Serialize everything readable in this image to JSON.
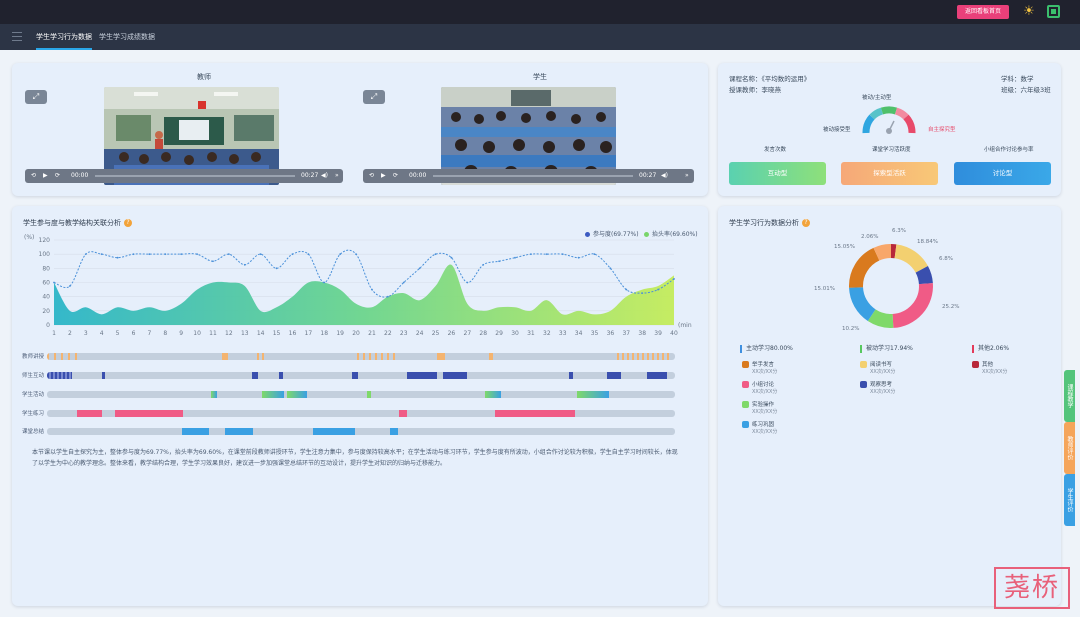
{
  "topbar": {
    "back_label": "返回看板首页",
    "theme_icon": "sun-icon",
    "screen_icon": "screen-icon"
  },
  "tabs": [
    {
      "label": "学生学习行为数据",
      "active": true
    },
    {
      "label": "学生学习成绩数据",
      "active": false
    }
  ],
  "video": {
    "teacher_label": "教师",
    "student_label": "学生",
    "teacher_player": {
      "current": "00:00",
      "duration": "00:27"
    },
    "student_player": {
      "current": "00:00",
      "duration": "00:27"
    }
  },
  "lesson_info": {
    "name_label": "课程名称：《平均数的运用》",
    "teacher_label": "授课教师：李晓燕",
    "subject_label": "学科：数学",
    "class_label": "班级：六年级3班",
    "gauge_title": "被动/主动型",
    "gauge_left": "被动接受型",
    "gauge_right": "自主探究型",
    "score_labels": [
      "发言次数",
      "课堂学习活跃度",
      "小组合作讨论参与率"
    ],
    "score_buttons": [
      "互动型",
      "探索型活跃",
      "讨论型"
    ],
    "button_colors": [
      "#8ee07a",
      "#f8b877",
      "#2f8ddc"
    ]
  },
  "engagement": {
    "title": "学生参与度与教学结构关联分析",
    "legend": [
      {
        "label": "参与度(69.77%)",
        "color": "#3c5bc2"
      },
      {
        "label": "抬头率(69.60%)",
        "color": "#79d56b"
      }
    ],
    "y_unit": "(%)",
    "x_unit": "(min)",
    "y_ticks": [
      "120",
      "100",
      "80",
      "60",
      "40",
      "20",
      "0"
    ],
    "x_ticks": [
      "1",
      "2",
      "3",
      "4",
      "5",
      "6",
      "7",
      "8",
      "9",
      "10",
      "11",
      "12",
      "13",
      "14",
      "15",
      "16",
      "17",
      "18",
      "19",
      "20",
      "21",
      "22",
      "23",
      "24",
      "25",
      "26",
      "27",
      "28",
      "29",
      "30",
      "31",
      "32",
      "33",
      "34",
      "35",
      "36",
      "37",
      "38",
      "39",
      "40"
    ],
    "row_labels": [
      "教师讲授",
      "师生互动",
      "学生活动",
      "学生练习",
      "课堂总结"
    ],
    "description": "本节课以学生自主探究为主，整体参与度为69.77%，抬头率为69.60%，在课堂前段教师讲授环节，学生注意力集中，参与度保持较高水平；在学生活动与练习环节，学生参与度有所波动，小组合作讨论较为积极，学生自主学习时间较长，体现了以学生为中心的教学理念。整体来看，教学结构合理，学生学习效果良好，建议进一步加强课堂总结环节的互动设计，提升学生对知识的归纳与迁移能力。",
    "chart_data": {
      "type": "line",
      "x": [
        1,
        2,
        3,
        4,
        5,
        6,
        7,
        8,
        9,
        10,
        11,
        12,
        13,
        14,
        15,
        16,
        17,
        18,
        19,
        20,
        21,
        22,
        23,
        24,
        25,
        26,
        27,
        28,
        29,
        30,
        31,
        32,
        33,
        34,
        35,
        36,
        37,
        38,
        39,
        40
      ],
      "ylim": [
        0,
        120
      ],
      "series": [
        {
          "name": "参与度(69.77%)",
          "values": [
            60,
            55,
            100,
            100,
            95,
            100,
            100,
            100,
            100,
            100,
            90,
            100,
            85,
            100,
            80,
            100,
            100,
            60,
            100,
            100,
            50,
            40,
            60,
            80,
            100,
            95,
            60,
            85,
            90,
            95,
            100,
            100,
            100,
            95,
            100,
            80,
            50,
            45,
            50,
            65
          ]
        },
        {
          "name": "抬头率(69.60%)",
          "values": [
            60,
            20,
            25,
            15,
            25,
            20,
            25,
            20,
            30,
            50,
            60,
            60,
            55,
            20,
            25,
            40,
            60,
            60,
            50,
            30,
            25,
            40,
            45,
            35,
            55,
            85,
            30,
            20,
            25,
            25,
            20,
            35,
            15,
            20,
            15,
            20,
            40,
            50,
            55,
            70
          ]
        }
      ]
    }
  },
  "behavior": {
    "title": "学生学习行为数据分析",
    "chart_data": {
      "type": "pie",
      "categories": [
        "主动学习",
        "被动学习",
        "其他"
      ],
      "values": [
        80.0,
        17.94,
        2.06
      ],
      "slice_labels": [
        "2.06%",
        "15.05%",
        "6.8%",
        "25.2%",
        "10.2%",
        "15.01%",
        "18.84%",
        "6.3%"
      ]
    },
    "summary": [
      {
        "label": "主动学习80.00%",
        "color": "#3f90e0"
      },
      {
        "label": "被动学习17.94%",
        "color": "#57c85f"
      },
      {
        "label": "其他2.06%",
        "color": "#e33a5a"
      }
    ],
    "items": [
      {
        "label": "举手发言",
        "sub": "XX次/XX分",
        "color": "#d97a1e"
      },
      {
        "label": "阅读书写",
        "sub": "XX次/XX分",
        "color": "#f3d070"
      },
      {
        "label": "其他",
        "sub": "XX次/XX分",
        "color": "#b8283a"
      },
      {
        "label": "小组讨论",
        "sub": "XX次/XX分",
        "color": "#f05b86"
      },
      {
        "label": "观察思考",
        "sub": "XX次/XX分",
        "color": "#3a4fae"
      },
      {
        "label": "实验操作",
        "sub": "XX次/XX分",
        "color": "#7fd96a"
      },
      {
        "label": "练习巩固",
        "sub": "XX次/XX分",
        "color": "#3aa0e3"
      }
    ]
  },
  "side_tabs": [
    {
      "label": "课程教学",
      "color": "#54c47a"
    },
    {
      "label": "教师评价",
      "color": "#f5a55a"
    },
    {
      "label": "学生评价",
      "color": "#3aa0e3"
    }
  ],
  "watermark": "荛桥"
}
